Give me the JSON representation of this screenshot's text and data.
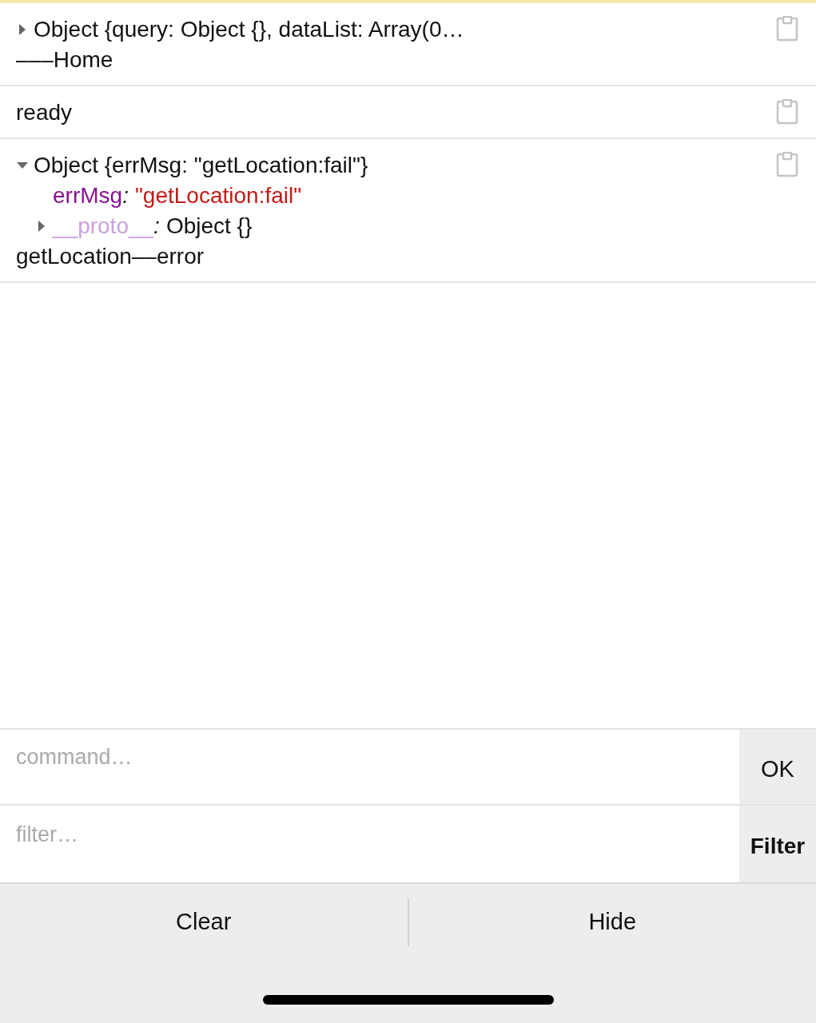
{
  "logs": [
    {
      "lines": [
        {
          "kind": "object",
          "expanded": false,
          "text": "Object {query: Object {}, dataList: Array(0…"
        },
        {
          "kind": "text",
          "text": "–––Home"
        }
      ]
    },
    {
      "lines": [
        {
          "kind": "text",
          "text": "ready"
        }
      ]
    },
    {
      "lines": [
        {
          "kind": "object",
          "expanded": true,
          "text": "Object {errMsg: \"getLocation:fail\"}",
          "children": [
            {
              "kind": "prop",
              "key": "errMsg",
              "separator": ":",
              "value": "\"getLocation:fail\""
            },
            {
              "kind": "proto",
              "expanded": false,
              "key": "__proto__",
              "separator": ":",
              "value": "Object {}"
            }
          ]
        },
        {
          "kind": "text",
          "text": "getLocation––error"
        }
      ]
    }
  ],
  "command": {
    "placeholder": "command…",
    "button": "OK"
  },
  "filter": {
    "placeholder": "filter…",
    "button": "Filter"
  },
  "toolbar": [
    "Clear",
    "Hide"
  ]
}
